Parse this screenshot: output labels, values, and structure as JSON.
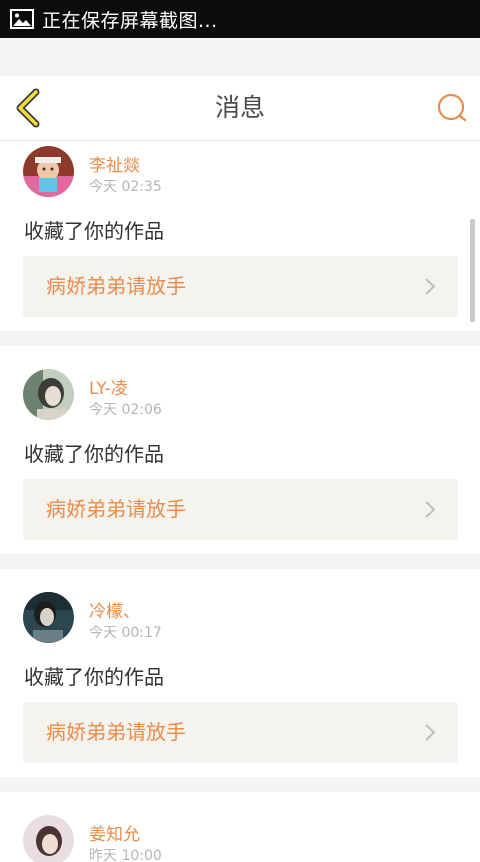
{
  "status_bar": {
    "text": "正在保存屏幕截图...",
    "icon": "image-icon"
  },
  "header": {
    "title": "消息",
    "back_icon": "back-arrow-icon",
    "search_icon": "search-icon"
  },
  "accent_color": "#e98c4c",
  "messages": [
    {
      "username": "李祉燚",
      "time": "今天 02:35",
      "action": "收藏了你的作品",
      "work_title": "病娇弟弟请放手"
    },
    {
      "username": "LY-凌",
      "time": "今天 02:06",
      "action": "收藏了你的作品",
      "work_title": "病娇弟弟请放手"
    },
    {
      "username": "冷檬、",
      "time": "今天 00:17",
      "action": "收藏了你的作品",
      "work_title": "病娇弟弟请放手"
    },
    {
      "username": "姜知允",
      "time": "昨天 10:00"
    }
  ]
}
